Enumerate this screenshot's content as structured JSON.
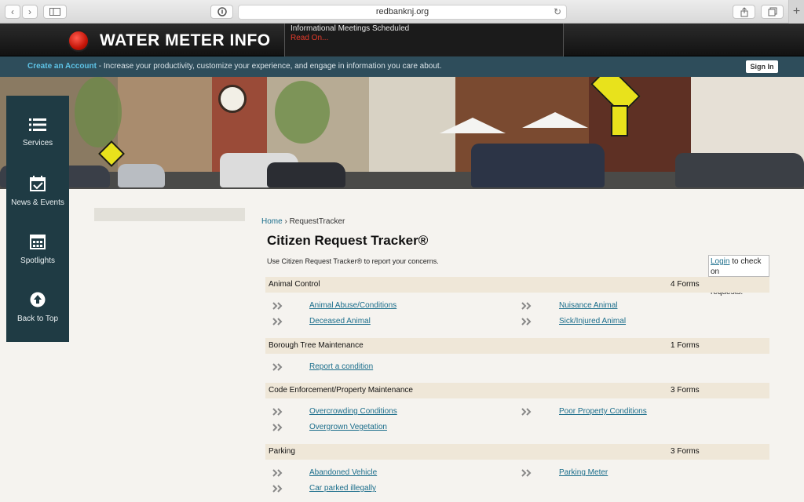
{
  "browser": {
    "url": "redbanknj.org"
  },
  "banner": {
    "title": "WATER METER INFO",
    "news_title": "Informational Meetings Scheduled",
    "news_more": "Read On..."
  },
  "account_bar": {
    "create_link": "Create an Account",
    "message": " - Increase your productivity, customize your experience, and engage in information you care about.",
    "signin": "Sign In"
  },
  "sidenav": [
    {
      "label": "Services",
      "icon": "list-icon"
    },
    {
      "label": "News & Events",
      "icon": "calendar-check-icon"
    },
    {
      "label": "Spotlights",
      "icon": "grid-calendar-icon"
    },
    {
      "label": "Back to Top",
      "icon": "arrow-up-circle-icon"
    }
  ],
  "breadcrumb": {
    "home": "Home",
    "separator": " › ",
    "current": "RequestTracker"
  },
  "page": {
    "title": "Citizen Request Tracker®",
    "intro": "Use Citizen Request Tracker® to report your concerns.",
    "login_link": "Login",
    "login_text_1": " to check on",
    "login_text_2": "existing requests."
  },
  "categories": [
    {
      "name": "Animal Control",
      "count": "4 Forms",
      "links": [
        "Animal Abuse/Conditions",
        "Nuisance Animal",
        "Deceased Animal",
        "Sick/Injured Animal"
      ]
    },
    {
      "name": "Borough Tree Maintenance",
      "count": "1 Forms",
      "links": [
        "Report a condition"
      ]
    },
    {
      "name": "Code Enforcement/Property Maintenance",
      "count": "3 Forms",
      "links": [
        "Overcrowding Conditions",
        "Poor Property Conditions",
        "Overgrown Vegetation"
      ]
    },
    {
      "name": "Parking",
      "count": "3 Forms",
      "links": [
        "Abandoned Vehicle",
        "Parking Meter",
        "Car parked illegally"
      ]
    }
  ],
  "colors": {
    "account_bar": "#2e4d5b",
    "sidenav": "#1f3b44",
    "link": "#1a6d8b",
    "category_bg": "#efe7d8",
    "news_more": "#e53a2a"
  }
}
